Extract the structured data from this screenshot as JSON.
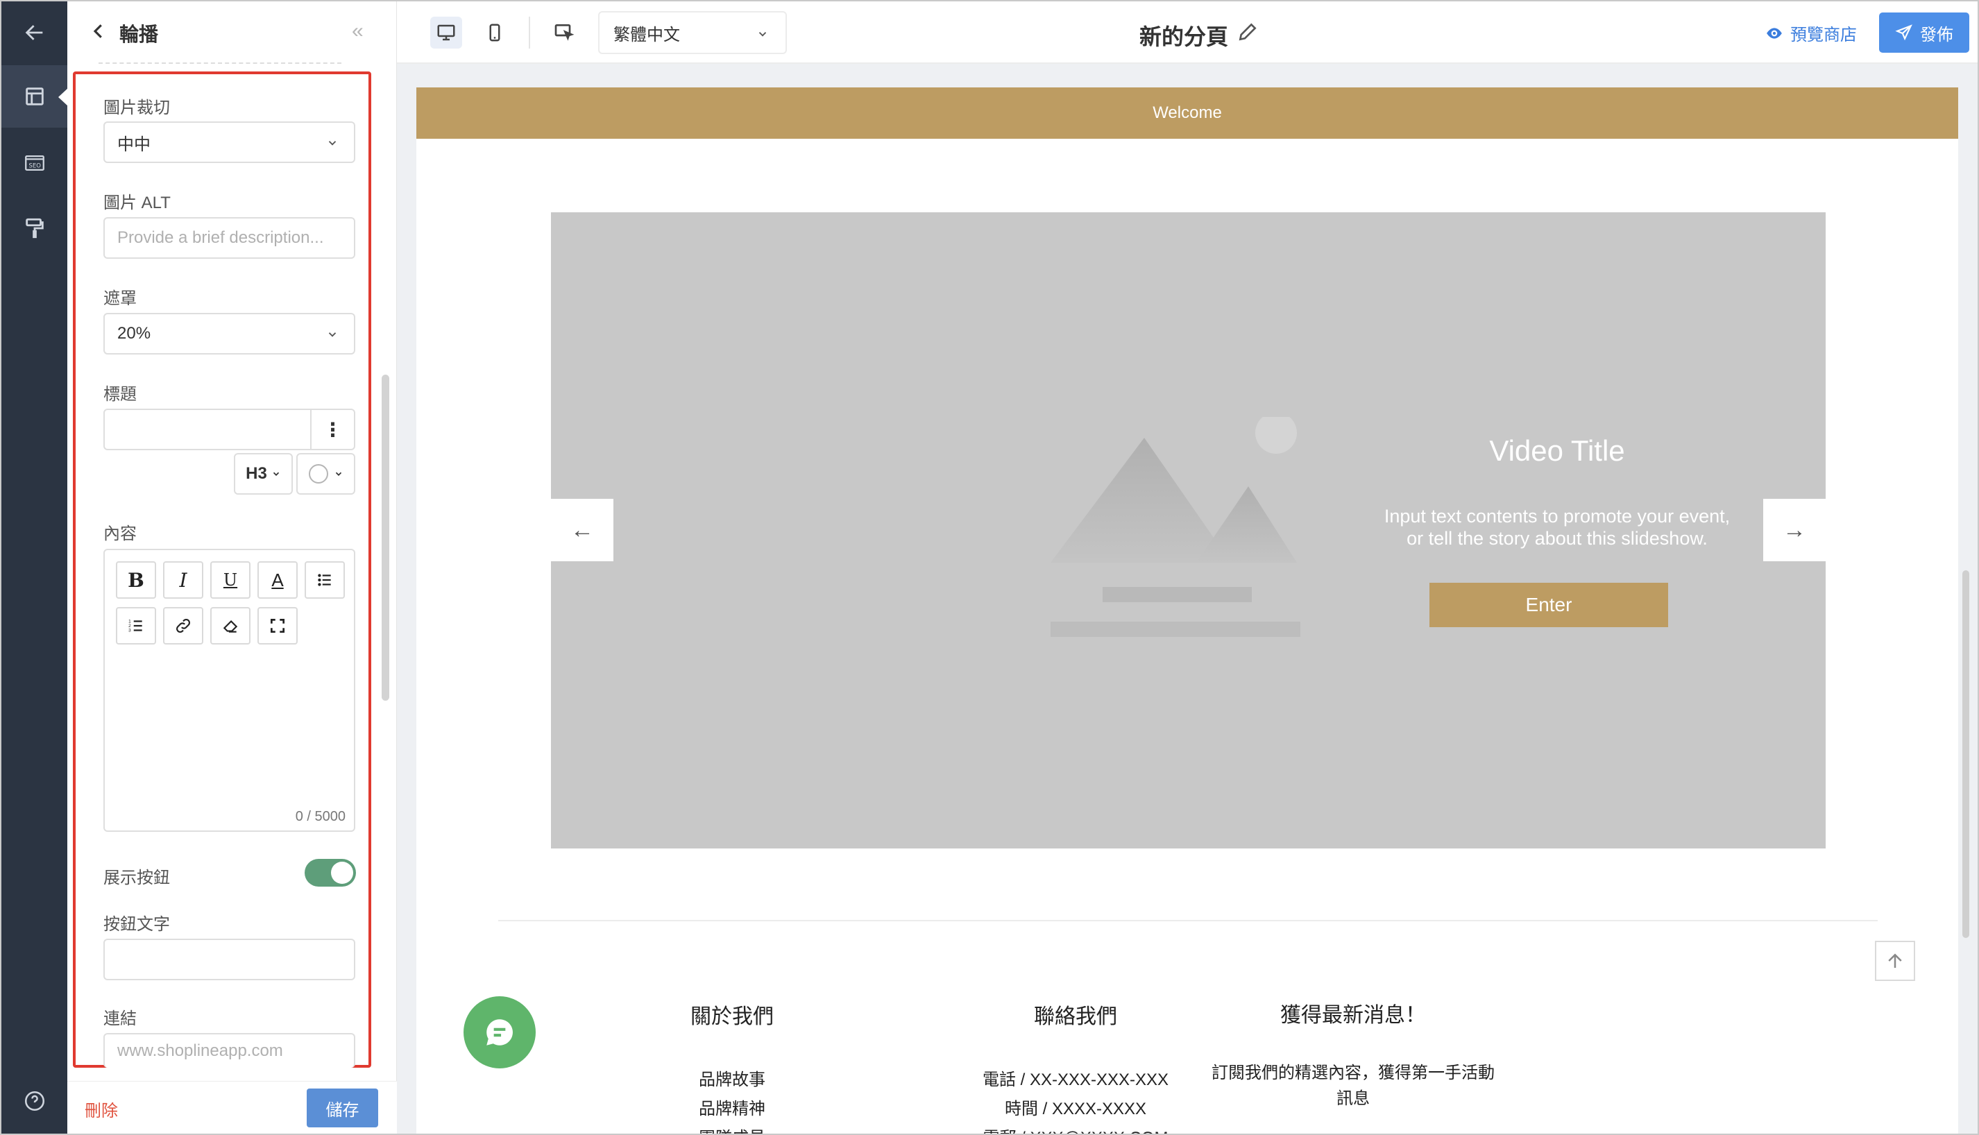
{
  "panel": {
    "title": "輪播",
    "fields": {
      "crop_label": "圖片裁切",
      "crop_value": "中中",
      "alt_label": "圖片 ALT",
      "alt_placeholder": "Provide a brief description...",
      "mask_label": "遮罩",
      "mask_value": "20%",
      "heading_label": "標題",
      "heading_level": "H3",
      "content_label": "內容",
      "char_counter": "0 / 5000",
      "show_button_label": "展示按鈕",
      "show_button_on": true,
      "button_text_label": "按鈕文字",
      "link_label": "連結",
      "link_placeholder": "www.shoplineapp.com"
    },
    "delete_label": "刪除",
    "save_label": "儲存"
  },
  "topbar": {
    "language": "繁體中文",
    "page_name": "新的分頁",
    "preview_label": "預覽商店",
    "publish_label": "發佈"
  },
  "preview": {
    "welcome": "Welcome",
    "slide": {
      "title": "Video Title",
      "desc_line1": "Input text contents to promote your event,",
      "desc_line2": "or tell the story about this slideshow.",
      "button": "Enter"
    },
    "footer": {
      "about_title": "關於我們",
      "about_items": [
        "品牌故事",
        "品牌精神",
        "團隊成員"
      ],
      "contact_title": "聯絡我們",
      "contact_items": [
        "電話 / XX-XXX-XXX-XXX",
        "時間 / XXXX-XXXX",
        "電郵 / XXX@XXXX.COM"
      ],
      "news_title": "獲得最新消息！",
      "news_line1": "訂閱我們的精選內容，獲得第一手活動",
      "news_line2": "訊息"
    }
  },
  "colors": {
    "rail": "#2b3442",
    "accent_gold": "#bd9c62",
    "primary_blue": "#4d8fe8",
    "toggle_on": "#5e9e7a",
    "highlight_red": "#e03a30"
  }
}
